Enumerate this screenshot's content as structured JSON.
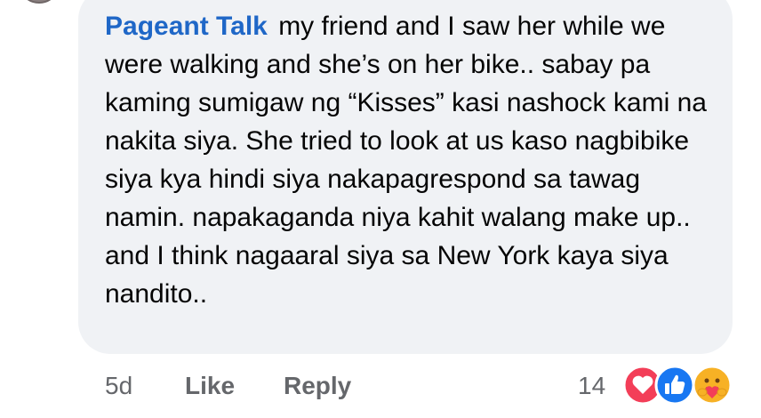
{
  "comment": {
    "author": "Pageant Talk",
    "body": "my friend and I saw her while we were walking and she’s on her bike.. sabay pa kaming sumigaw ng “Kisses” kasi nashock kami na nakita siya. She tried to look at us kaso nagbibike siya kya hindi siya nakapagrespond sa tawag namin. napakaganda niya kahit walang make up.. and I think nagaaral siya sa New York kaya siya nandito..",
    "time": "5d",
    "like_label": "Like",
    "reply_label": "Reply",
    "reaction_count": "14",
    "reactions": [
      "heart-icon",
      "thumbs-up-icon",
      "care-icon"
    ]
  },
  "colors": {
    "author": "#1f67c7",
    "bubble": "#f0f2f5",
    "meta": "#65676b",
    "heart": "#f33e58",
    "like": "#1877f2",
    "care": "#f7b125"
  }
}
